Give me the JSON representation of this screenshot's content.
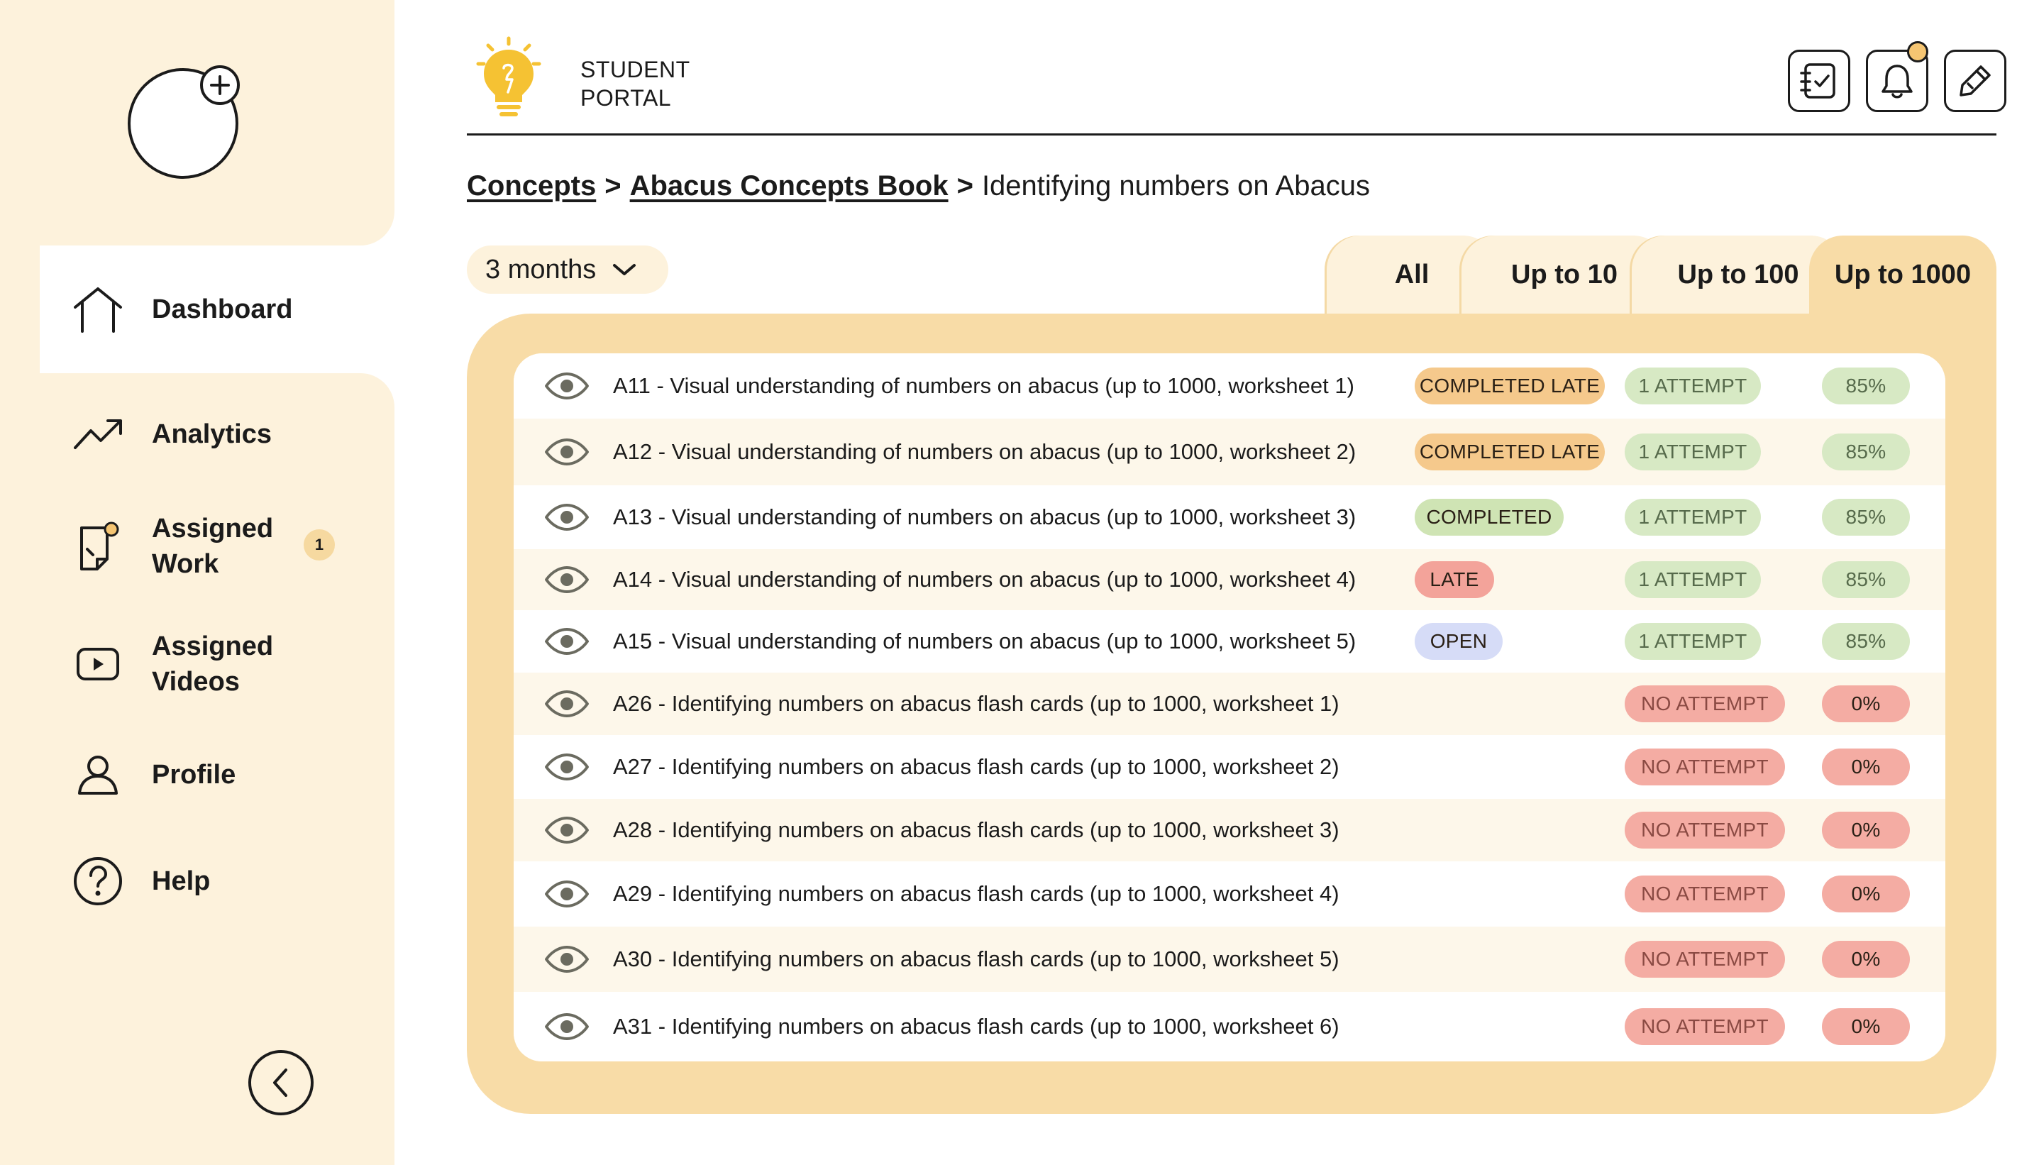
{
  "brand": {
    "line1": "STUDENT",
    "line2": "PORTAL"
  },
  "sidebar": {
    "items": [
      {
        "label": "Dashboard",
        "icon": "home-icon"
      },
      {
        "label": "Analytics",
        "icon": "trend-icon"
      },
      {
        "label": "Assigned Work",
        "line1": "Assigned",
        "line2": "Work",
        "badge": "1",
        "icon": "assignment-icon"
      },
      {
        "label": "Assigned Videos",
        "line1": "Assigned",
        "line2": "Videos",
        "icon": "video-icon"
      },
      {
        "label": "Profile",
        "icon": "user-icon"
      },
      {
        "label": "Help",
        "icon": "help-icon"
      }
    ],
    "active": "Dashboard"
  },
  "header": {
    "icons": [
      "checklist-icon",
      "bell-icon",
      "edit-icon"
    ]
  },
  "breadcrumb": {
    "c1": "Concepts",
    "c2": "Abacus Concepts Book",
    "current": "Identifying numbers on Abacus",
    "sep": ">"
  },
  "filter": {
    "range": "3 months"
  },
  "tabs": {
    "t1": "All",
    "t2": "Up to 10",
    "t3": "Up to 100",
    "t4": "Up to 1000",
    "active": "Up to 1000"
  },
  "rows": [
    {
      "title": "A11 - Visual understanding of numbers on abacus (up to 1000, worksheet 1)",
      "status": "COMPLETED LATE",
      "attempt": "1 ATTEMPT",
      "score": "85%"
    },
    {
      "title": "A12 - Visual understanding of numbers on abacus (up to 1000, worksheet 2)",
      "status": "COMPLETED LATE",
      "attempt": "1 ATTEMPT",
      "score": "85%"
    },
    {
      "title": "A13 - Visual understanding of numbers on abacus (up to 1000, worksheet 3)",
      "status": "COMPLETED",
      "attempt": "1 ATTEMPT",
      "score": "85%"
    },
    {
      "title": "A14 - Visual understanding of numbers on abacus (up to 1000, worksheet 4)",
      "status": "LATE",
      "attempt": "1 ATTEMPT",
      "score": "85%"
    },
    {
      "title": "A15 - Visual understanding of numbers on abacus (up to 1000, worksheet 5)",
      "status": "OPEN",
      "attempt": "1 ATTEMPT",
      "score": "85%"
    },
    {
      "title": "A26 - Identifying numbers on abacus flash cards (up to 1000, worksheet 1)",
      "status": "",
      "attempt": "NO ATTEMPT",
      "score": "0%"
    },
    {
      "title": "A27 - Identifying numbers on abacus flash cards (up to 1000, worksheet 2)",
      "status": "",
      "attempt": "NO ATTEMPT",
      "score": "0%"
    },
    {
      "title": "A28 - Identifying numbers on abacus flash cards (up to 1000, worksheet 3)",
      "status": "",
      "attempt": "NO ATTEMPT",
      "score": "0%"
    },
    {
      "title": "A29 - Identifying numbers on abacus flash cards (up to 1000, worksheet 4)",
      "status": "",
      "attempt": "NO ATTEMPT",
      "score": "0%"
    },
    {
      "title": "A30 - Identifying numbers on abacus flash cards (up to 1000, worksheet 5)",
      "status": "",
      "attempt": "NO ATTEMPT",
      "score": "0%"
    },
    {
      "title": "A31 - Identifying numbers on abacus flash cards (up to 1000, worksheet 6)",
      "status": "",
      "attempt": "NO ATTEMPT",
      "score": "0%"
    }
  ],
  "colors": {
    "sidebar_bg": "#fdf2dc",
    "panel_bg": "#f8dca7",
    "completed_late": "#f5c98c",
    "completed": "#cfe4b4",
    "late": "#f3a39a",
    "open": "#d6dcf7",
    "ok_pill": "#d7e9c4",
    "no_pill": "#f4aca3",
    "accent": "#f5c233"
  }
}
